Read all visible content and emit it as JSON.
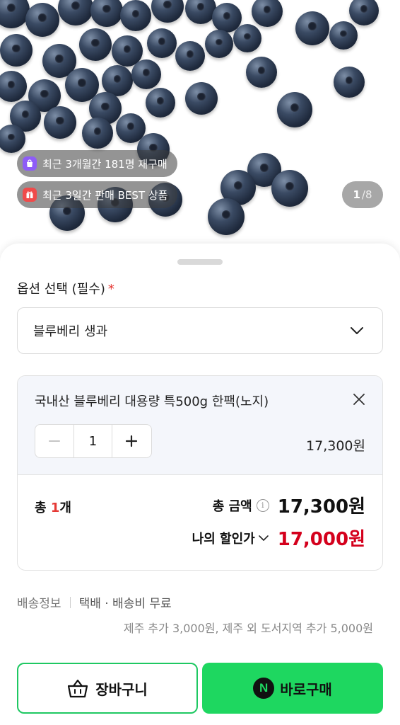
{
  "hero": {
    "badges": [
      {
        "icon": "shopping-bag-icon",
        "color": "#8e5cf7",
        "text": "최근 3개월간 181명 재구매"
      },
      {
        "icon": "gift-icon",
        "color": "#f04b4b",
        "text": "최근 3일간 판매 BEST 상품"
      }
    ],
    "counter": {
      "current": "1",
      "total": "/8"
    }
  },
  "option": {
    "title": "옵션 선택 (필수)",
    "required_mark": "*",
    "selected": "블루베리 생과"
  },
  "item": {
    "name": "국내산 블루베리 대용량 특500g 한팩(노지)",
    "quantity": "1",
    "price": "17,300원"
  },
  "summary": {
    "total_prefix": "총 ",
    "count": "1",
    "count_suffix": "개",
    "total_label": "총 금액",
    "total_value": "17,300원",
    "discount_label": "나의 할인가",
    "discount_value": "17,000원"
  },
  "shipping": {
    "label": "배송정보",
    "info": "택배 · 배송비 무료",
    "note": "제주 추가 3,000원, 제주 외 도서지역 추가 5,000원"
  },
  "buttons": {
    "cart_label": "장바구니",
    "buy_label": "바로구매",
    "buy_icon_letter": "N"
  },
  "colors": {
    "accent_green": "#1ed760",
    "price_red": "#d4001c",
    "required_red": "#e53935"
  }
}
